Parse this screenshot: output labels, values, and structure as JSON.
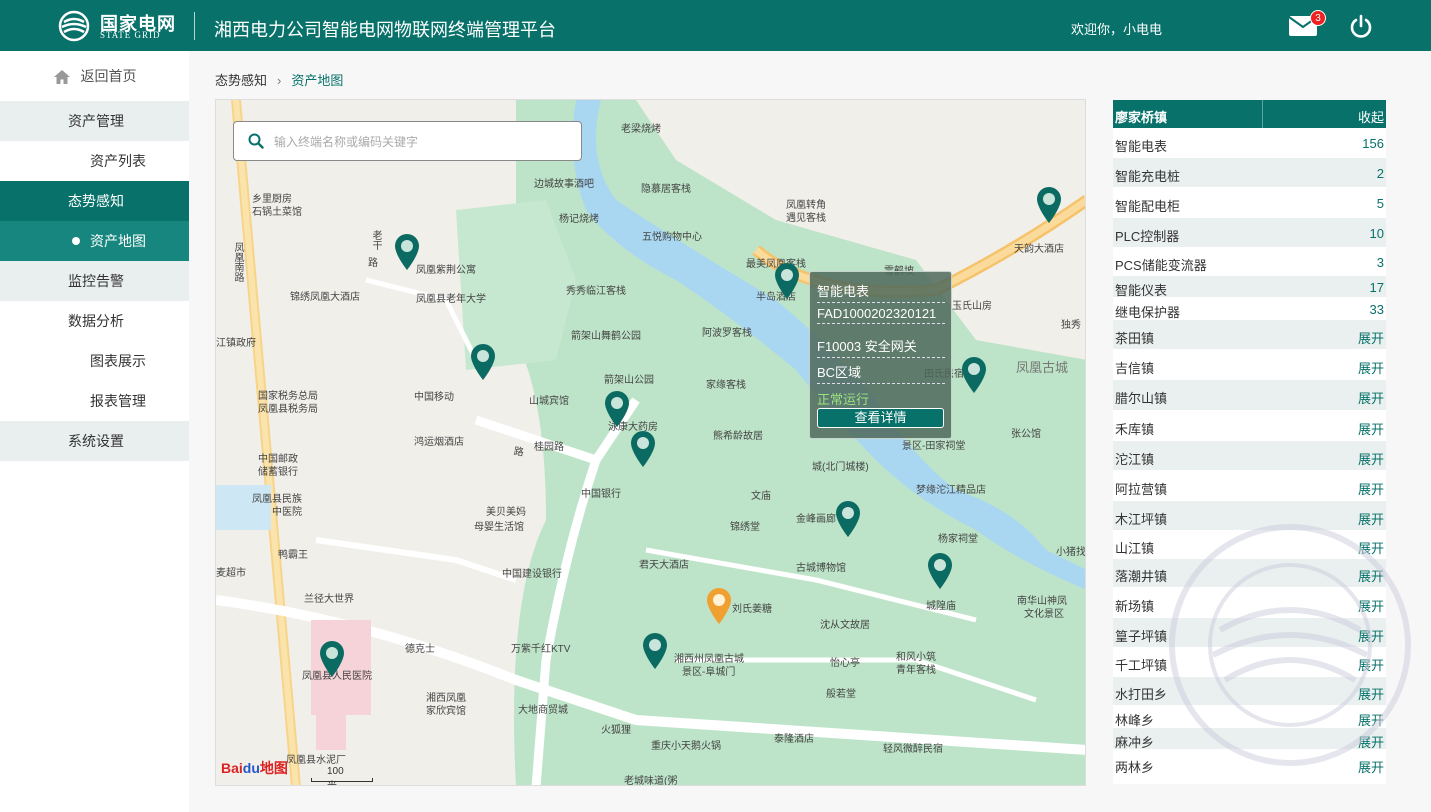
{
  "header": {
    "logo_cn": "国家电网",
    "logo_en": "STATE GRID",
    "title": "湘西电力公司智能电网物联网终端管理平台",
    "welcome": "欢迎你，小电电",
    "mail_count": "3"
  },
  "sidebar": {
    "home": "返回首页",
    "items": [
      {
        "label": "资产管理"
      },
      {
        "label": "资产列表"
      },
      {
        "label": "态势感知"
      },
      {
        "label": "资产地图"
      },
      {
        "label": "监控告警"
      },
      {
        "label": "数据分析"
      },
      {
        "label": "图表展示"
      },
      {
        "label": "报表管理"
      },
      {
        "label": "系统设置"
      }
    ]
  },
  "breadcrumb": {
    "parent": "态势感知",
    "current": "资产地图"
  },
  "map": {
    "search_placeholder": "输入终端名称或编码关键字",
    "labels": [
      "老梁烧烤",
      "乡里厨房",
      "石锅土菜馆",
      "边城故事酒吧",
      "隐慕居客栈",
      "凤凰转角",
      "遇见客栈",
      "杨记烧烤",
      "五悦购物中心",
      "凤凰紫荆公寓",
      "凤凰县老年大学",
      "秀秀临江客栈",
      "最美凤凰客栈",
      "半岛酒店",
      "雪鹤坡",
      "天韵大酒店",
      "玉氏山房",
      "锦绣凤凰大酒店",
      "江镇政府",
      "箭架山舞鹤公园",
      "阿波罗客栈",
      "箭架山公园",
      "家缘客栈",
      "田氏民宿",
      "独秀",
      "凤凰古城",
      "国家税务总局",
      "凤凰县税务局",
      "中国移动",
      "山城宾馆",
      "泳康大药房",
      "熊希龄故居",
      "景区-田家祠堂",
      "张公馆",
      "鸿运烟酒店",
      "桂园路",
      "城(北门城楼)",
      "中国邮政",
      "储蓄银行",
      "中国银行",
      "文庙",
      "梦缘沱江精品店",
      "凤凰县民族",
      "中医院",
      "美贝美妈",
      "母婴生活馆",
      "锦绣堂",
      "金峰画廊",
      "杨家祠堂",
      "小猪找",
      "鸭霸王",
      "中国建设银行",
      "君天大酒店",
      "古城博物馆",
      "城隍庙",
      "南华山神凤",
      "文化景区",
      "麦超市",
      "兰径大世界",
      "刘氏姜糖",
      "沈从文故居",
      "德克士",
      "万紫千红KTV",
      "湘西州凤凰古城",
      "景区-阜城门",
      "怡心亭",
      "和风小筑",
      "青年客栈",
      "凤凰县人民医院",
      "湘西凤凰",
      "家欣宾馆",
      "大地商贸城",
      "般若堂",
      "火狐狸",
      "泰隆酒店",
      "凤凰县水泥厂",
      "重庆小天鹅火锅",
      "轻风微醉民宿",
      "老城味道(粥",
      "路",
      "凤凰南路",
      "老干",
      "路"
    ],
    "baidu_text": "Bai",
    "baidu_du": "du",
    "baidu_map": "地图",
    "scale": "100 米",
    "popup": {
      "type": "智能电表",
      "code": "FAD1000202320121",
      "gateway": "F10003 安全网关",
      "area": "BC区域",
      "status": "正常运行",
      "button": "查看详情"
    }
  },
  "panel": {
    "title": "廖家桥镇",
    "collapse": "收起",
    "assets": [
      {
        "name": "智能电表",
        "value": "156"
      },
      {
        "name": "智能充电桩",
        "value": "2"
      },
      {
        "name": "智能配电柜",
        "value": "5"
      },
      {
        "name": "PLC控制器",
        "value": "10"
      },
      {
        "name": "PCS储能变流器",
        "value": "3"
      },
      {
        "name": "智能仪表",
        "value": "17"
      },
      {
        "name": "继电保护器",
        "value": "33"
      }
    ],
    "towns": [
      {
        "name": "茶田镇",
        "action": "展开"
      },
      {
        "name": "吉信镇",
        "action": "展开"
      },
      {
        "name": "腊尔山镇",
        "action": "展开"
      },
      {
        "name": "禾库镇",
        "action": "展开"
      },
      {
        "name": "沱江镇",
        "action": "展开"
      },
      {
        "name": "阿拉营镇",
        "action": "展开"
      },
      {
        "name": "木江坪镇",
        "action": "展开"
      },
      {
        "name": "山江镇",
        "action": "展开"
      },
      {
        "name": "落潮井镇",
        "action": "展开"
      },
      {
        "name": "新场镇",
        "action": "展开"
      },
      {
        "name": "篁子坪镇",
        "action": "展开"
      },
      {
        "name": "千工坪镇",
        "action": "展开"
      },
      {
        "name": "水打田乡",
        "action": "展开"
      },
      {
        "name": "林峰乡",
        "action": "展开"
      },
      {
        "name": "麻冲乡",
        "action": "展开"
      },
      {
        "name": "两林乡",
        "action": "展开"
      }
    ]
  },
  "colors": {
    "brand": "#07716a",
    "pin": "#0b6b62",
    "pin_selected": "#f0a030",
    "park": "#bde3c9",
    "river": "#a9d7f2"
  }
}
